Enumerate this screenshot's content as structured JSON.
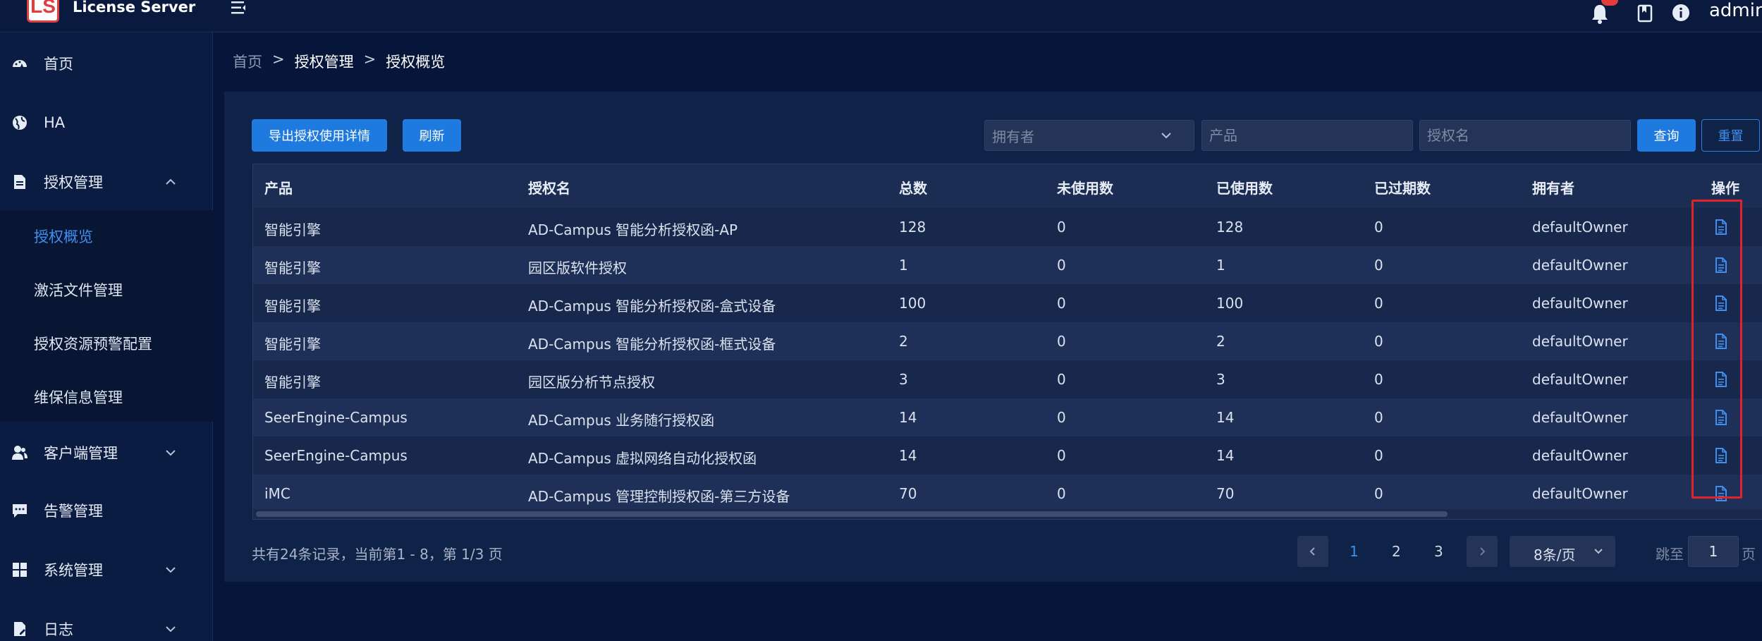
{
  "app": {
    "logo_text": "LS",
    "title": "License Server",
    "user": "admin"
  },
  "sidebar": {
    "items": [
      {
        "label": "首页",
        "icon": "dashboard-icon"
      },
      {
        "label": "HA",
        "icon": "globe-icon"
      },
      {
        "label": "授权管理",
        "icon": "document-icon",
        "expanded": true
      },
      {
        "label": "客户端管理",
        "icon": "users-icon"
      },
      {
        "label": "告警管理",
        "icon": "message-icon"
      },
      {
        "label": "系统管理",
        "icon": "grid-icon"
      },
      {
        "label": "日志",
        "icon": "log-icon"
      }
    ],
    "submenu": [
      "授权概览",
      "激活文件管理",
      "授权资源预警配置",
      "维保信息管理"
    ]
  },
  "breadcrumb": {
    "home": "首页",
    "sep": ">",
    "parent": "授权管理",
    "current": "授权概览"
  },
  "toolbar": {
    "export_label": "导出授权使用详情",
    "refresh_label": "刷新",
    "owner_placeholder": "拥有者",
    "product_placeholder": "产品",
    "license_placeholder": "授权名",
    "query_label": "查询",
    "reset_label": "重置"
  },
  "table": {
    "headers": [
      "产品",
      "授权名",
      "总数",
      "未使用数",
      "已使用数",
      "已过期数",
      "拥有者",
      "操作"
    ],
    "rows": [
      [
        "智能引擎",
        "AD-Campus 智能分析授权函-AP",
        "128",
        "0",
        "128",
        "0",
        "defaultOwner"
      ],
      [
        "智能引擎",
        "园区版软件授权",
        "1",
        "0",
        "1",
        "0",
        "defaultOwner"
      ],
      [
        "智能引擎",
        "AD-Campus 智能分析授权函-盒式设备",
        "100",
        "0",
        "100",
        "0",
        "defaultOwner"
      ],
      [
        "智能引擎",
        "AD-Campus 智能分析授权函-框式设备",
        "2",
        "0",
        "2",
        "0",
        "defaultOwner"
      ],
      [
        "智能引擎",
        "园区版分析节点授权",
        "3",
        "0",
        "3",
        "0",
        "defaultOwner"
      ],
      [
        "SeerEngine-Campus",
        "AD-Campus 业务随行授权函",
        "14",
        "0",
        "14",
        "0",
        "defaultOwner"
      ],
      [
        "SeerEngine-Campus",
        "AD-Campus 虚拟网络自动化授权函",
        "14",
        "0",
        "14",
        "0",
        "defaultOwner"
      ],
      [
        "iMC",
        "AD-Campus 管理控制授权函-第三方设备",
        "70",
        "0",
        "70",
        "0",
        "defaultOwner"
      ]
    ]
  },
  "pagination": {
    "summary": "共有24条记录，当前第1 - 8，第 1/3 页",
    "pages": [
      "1",
      "2",
      "3"
    ],
    "current_page": "1",
    "page_size": "8条/页",
    "jump_label": "跳至",
    "jump_value": "1",
    "jump_suffix": "页"
  },
  "colors": {
    "accent": "#1f7ae0",
    "highlight": "#e0242a",
    "background": "#06153a"
  }
}
